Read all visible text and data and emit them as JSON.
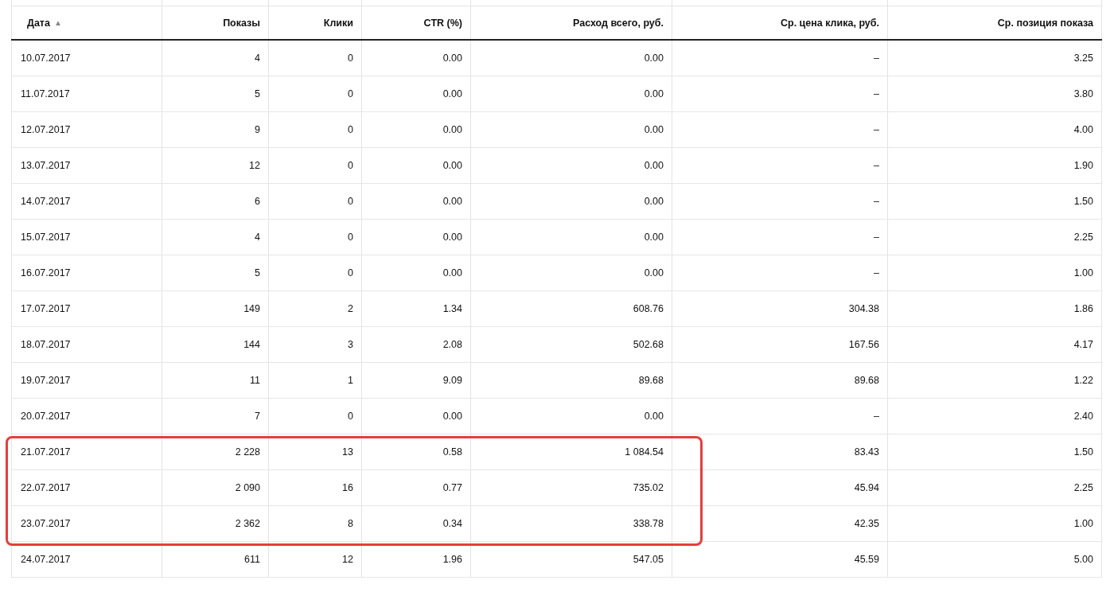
{
  "table": {
    "columns": [
      {
        "label": "Дата",
        "sort_icon": "▲"
      },
      {
        "label": "Показы"
      },
      {
        "label": "Клики"
      },
      {
        "label": "CTR (%)"
      },
      {
        "label": "Расход всего, руб."
      },
      {
        "label": "Ср. цена клика, руб."
      },
      {
        "label": "Ср. позиция показа"
      }
    ],
    "rows": [
      {
        "cells": [
          "10.07.2017",
          "4",
          "0",
          "0.00",
          "0.00",
          "–",
          "3.25"
        ],
        "highlighted": false
      },
      {
        "cells": [
          "11.07.2017",
          "5",
          "0",
          "0.00",
          "0.00",
          "–",
          "3.80"
        ],
        "highlighted": false
      },
      {
        "cells": [
          "12.07.2017",
          "9",
          "0",
          "0.00",
          "0.00",
          "–",
          "4.00"
        ],
        "highlighted": false
      },
      {
        "cells": [
          "13.07.2017",
          "12",
          "0",
          "0.00",
          "0.00",
          "–",
          "1.90"
        ],
        "highlighted": false
      },
      {
        "cells": [
          "14.07.2017",
          "6",
          "0",
          "0.00",
          "0.00",
          "–",
          "1.50"
        ],
        "highlighted": false
      },
      {
        "cells": [
          "15.07.2017",
          "4",
          "0",
          "0.00",
          "0.00",
          "–",
          "2.25"
        ],
        "highlighted": false
      },
      {
        "cells": [
          "16.07.2017",
          "5",
          "0",
          "0.00",
          "0.00",
          "–",
          "1.00"
        ],
        "highlighted": false
      },
      {
        "cells": [
          "17.07.2017",
          "149",
          "2",
          "1.34",
          "608.76",
          "304.38",
          "1.86"
        ],
        "highlighted": false
      },
      {
        "cells": [
          "18.07.2017",
          "144",
          "3",
          "2.08",
          "502.68",
          "167.56",
          "4.17"
        ],
        "highlighted": false
      },
      {
        "cells": [
          "19.07.2017",
          "11",
          "1",
          "9.09",
          "89.68",
          "89.68",
          "1.22"
        ],
        "highlighted": false
      },
      {
        "cells": [
          "20.07.2017",
          "7",
          "0",
          "0.00",
          "0.00",
          "–",
          "2.40"
        ],
        "highlighted": false
      },
      {
        "cells": [
          "21.07.2017",
          "2 228",
          "13",
          "0.58",
          "1 084.54",
          "83.43",
          "1.50"
        ],
        "highlighted": true
      },
      {
        "cells": [
          "22.07.2017",
          "2 090",
          "16",
          "0.77",
          "735.02",
          "45.94",
          "2.25"
        ],
        "highlighted": true
      },
      {
        "cells": [
          "23.07.2017",
          "2 362",
          "8",
          "0.34",
          "338.78",
          "42.35",
          "1.00"
        ],
        "highlighted": true
      },
      {
        "cells": [
          "24.07.2017",
          "611",
          "12",
          "1.96",
          "547.05",
          "45.59",
          "5.00"
        ],
        "highlighted": false
      }
    ]
  }
}
